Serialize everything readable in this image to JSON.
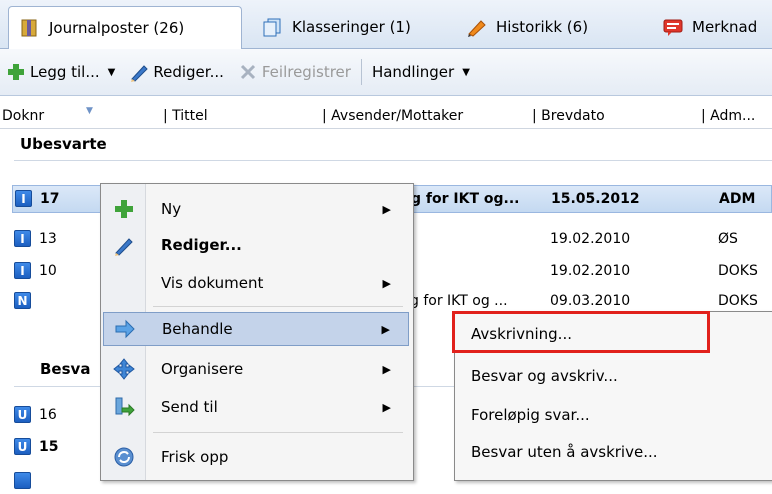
{
  "tabs": [
    {
      "label": "Journalposter (26)",
      "icon": "journal-icon"
    },
    {
      "label": "Klasseringer (1)",
      "icon": "files-icon"
    },
    {
      "label": "Historikk (6)",
      "icon": "history-pen-icon"
    },
    {
      "label": "Merknad",
      "icon": "comment-icon"
    }
  ],
  "toolbar": {
    "add_label": "Legg til...",
    "edit_label": "Rediger...",
    "misregister_label": "Feilregistrer",
    "actions_label": "Handlinger"
  },
  "columns": [
    "Doknr",
    "| Tittel",
    "| Avsender/Mottaker",
    "| Brevdato",
    "| Adm..."
  ],
  "groups": {
    "unanswered": "Ubesvarte",
    "answered": "Besva"
  },
  "rows_unanswered": [
    {
      "badge": "I",
      "doknr": "17",
      "title": "g for IKT og...",
      "date": "15.05.2012",
      "adm": "ADM",
      "bold": true
    },
    {
      "badge": "I",
      "doknr": "13",
      "title": "",
      "date": "19.02.2010",
      "adm": "ØS"
    },
    {
      "badge": "I",
      "doknr": "10",
      "title": "",
      "date": "19.02.2010",
      "adm": "DOKS"
    },
    {
      "badge": "N",
      "doknr": "",
      "title": "g for IKT og ...",
      "date": "09.03.2010",
      "adm": "DOKS"
    }
  ],
  "rows_answered": [
    {
      "badge": "U",
      "doknr": "16"
    },
    {
      "badge": "U",
      "doknr": "15",
      "bold": true
    }
  ],
  "context_menu": [
    {
      "label": "Ny",
      "icon": "plus-icon",
      "submenu": true
    },
    {
      "label": "Rediger...",
      "icon": "pencil-icon",
      "bold": true
    },
    {
      "label": "Vis dokument",
      "icon": "",
      "submenu": true
    },
    {
      "label": "Behandle",
      "icon": "process-icon",
      "submenu": true,
      "highlighted": true
    },
    {
      "label": "Organisere",
      "icon": "move-icon",
      "submenu": true
    },
    {
      "label": "Send til",
      "icon": "send-icon",
      "submenu": true
    },
    {
      "label": "Frisk opp",
      "icon": "refresh-icon"
    }
  ],
  "submenu": [
    "Avskrivning...",
    "Besvar og avskriv...",
    "Foreløpig svar...",
    "Besvar uten å avskrive..."
  ]
}
